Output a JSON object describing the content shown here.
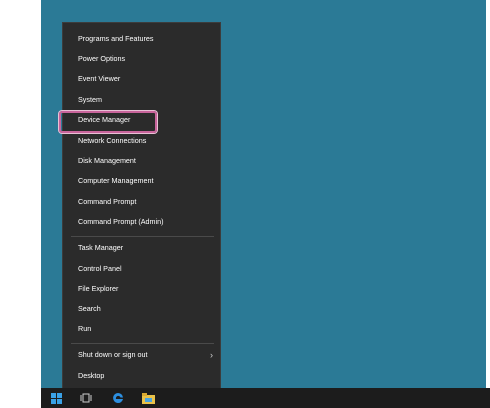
{
  "menu": {
    "groups": [
      [
        "Programs and Features",
        "Power Options",
        "Event Viewer",
        "System",
        "Device Manager",
        "Network Connections",
        "Disk Management",
        "Computer Management",
        "Command Prompt",
        "Command Prompt (Admin)"
      ],
      [
        "Task Manager",
        "Control Panel",
        "File Explorer",
        "Search",
        "Run"
      ],
      [
        "Shut down or sign out",
        "Desktop"
      ]
    ],
    "highlighted_item": "Device Manager"
  },
  "taskbar": {
    "icons": [
      "windows-start-icon",
      "task-view-icon",
      "edge-browser-icon",
      "file-explorer-icon"
    ]
  },
  "colors": {
    "desktop": "#2b7a96",
    "menu_bg": "#2b2b2b",
    "highlight_border": "#c8649b",
    "taskbar": "#1c1c1c"
  }
}
